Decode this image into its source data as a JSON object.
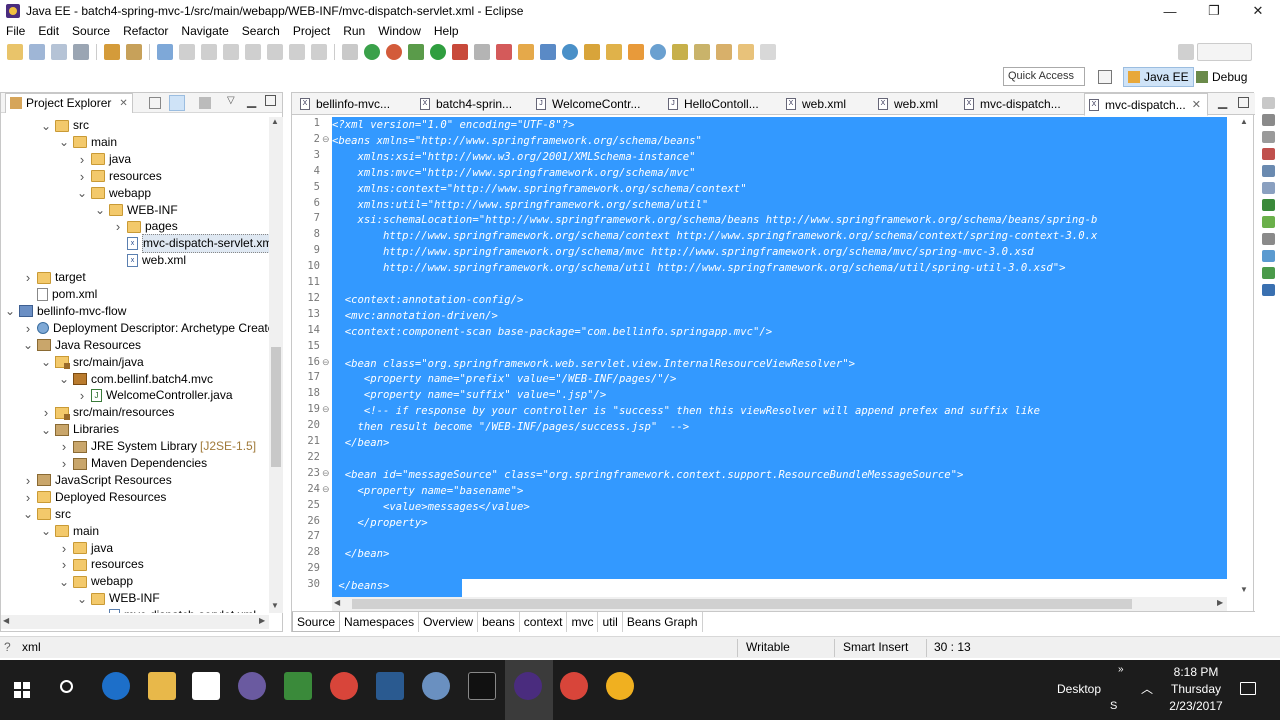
{
  "window": {
    "title": "Java EE - batch4-spring-mvc-1/src/main/webapp/WEB-INF/mvc-dispatch-servlet.xml - Eclipse",
    "controls": {
      "minimize": "—",
      "restore": "❐",
      "close": "✕"
    }
  },
  "menu": [
    "File",
    "Edit",
    "Source",
    "Refactor",
    "Navigate",
    "Search",
    "Project",
    "Run",
    "Window",
    "Help"
  ],
  "toolbar_right": {
    "quick_access": "Quick Access",
    "perspectives": [
      {
        "label": "Java EE",
        "active": true
      },
      {
        "label": "Debug",
        "active": false
      }
    ]
  },
  "explorer": {
    "title": "Project Explorer",
    "close": "✕",
    "tree": [
      {
        "label": "src",
        "depth": 2,
        "icon": "folder",
        "expanded": true
      },
      {
        "label": "main",
        "depth": 3,
        "icon": "folder",
        "expanded": true
      },
      {
        "label": "java",
        "depth": 4,
        "icon": "folder",
        "expanded": false
      },
      {
        "label": "resources",
        "depth": 4,
        "icon": "folder",
        "expanded": false
      },
      {
        "label": "webapp",
        "depth": 4,
        "icon": "folder",
        "expanded": true
      },
      {
        "label": "WEB-INF",
        "depth": 5,
        "icon": "folder",
        "expanded": true
      },
      {
        "label": "pages",
        "depth": 6,
        "icon": "folder",
        "expanded": false
      },
      {
        "label": "mvc-dispatch-servlet.xml",
        "depth": 6,
        "icon": "xml",
        "selected": true
      },
      {
        "label": "web.xml",
        "depth": 6,
        "icon": "xml"
      },
      {
        "label": "target",
        "depth": 1,
        "icon": "folder",
        "expanded": false
      },
      {
        "label": "pom.xml",
        "depth": 1,
        "icon": "file"
      },
      {
        "label": "bellinfo-mvc-flow",
        "depth": 0,
        "icon": "proj",
        "expanded": true
      },
      {
        "label": "Deployment Descriptor: Archetype Create",
        "depth": 1,
        "icon": "globe",
        "expanded": false
      },
      {
        "label": "Java Resources",
        "depth": 1,
        "icon": "lib",
        "expanded": true
      },
      {
        "label": "src/main/java",
        "depth": 2,
        "icon": "pkgfolder",
        "expanded": true
      },
      {
        "label": "com.bellinf.batch4.mvc",
        "depth": 3,
        "icon": "pkg",
        "expanded": true
      },
      {
        "label": "WelcomeController.java",
        "depth": 4,
        "icon": "java",
        "expanded": false
      },
      {
        "label": "src/main/resources",
        "depth": 2,
        "icon": "pkgfolder",
        "expanded": false
      },
      {
        "label": "Libraries",
        "depth": 2,
        "icon": "lib",
        "expanded": true
      },
      {
        "label": "JRE System Library",
        "depth": 3,
        "icon": "lib",
        "decoration": "[J2SE-1.5]",
        "expanded": false
      },
      {
        "label": "Maven Dependencies",
        "depth": 3,
        "icon": "lib",
        "expanded": false
      },
      {
        "label": "JavaScript Resources",
        "depth": 1,
        "icon": "lib",
        "expanded": false
      },
      {
        "label": "Deployed Resources",
        "depth": 1,
        "icon": "folder",
        "expanded": false
      },
      {
        "label": "src",
        "depth": 1,
        "icon": "folder",
        "expanded": true
      },
      {
        "label": "main",
        "depth": 2,
        "icon": "folder",
        "expanded": true
      },
      {
        "label": "java",
        "depth": 3,
        "icon": "folder",
        "expanded": false
      },
      {
        "label": "resources",
        "depth": 3,
        "icon": "folder",
        "expanded": false
      },
      {
        "label": "webapp",
        "depth": 3,
        "icon": "folder",
        "expanded": true
      },
      {
        "label": "WEB-INF",
        "depth": 4,
        "icon": "folder",
        "expanded": true
      },
      {
        "label": "mvc-dispatch-servlet.xml",
        "depth": 5,
        "icon": "xml"
      }
    ]
  },
  "editor": {
    "tabs": [
      {
        "label": "bellinfo-mvc...",
        "icon": "X"
      },
      {
        "label": "batch4-sprin...",
        "icon": "X"
      },
      {
        "label": "WelcomeContr...",
        "icon": "J"
      },
      {
        "label": "HelloContoll...",
        "icon": "J"
      },
      {
        "label": "web.xml",
        "icon": "X"
      },
      {
        "label": "web.xml",
        "icon": "X"
      },
      {
        "label": "mvc-dispatch...",
        "icon": "X"
      },
      {
        "label": "mvc-dispatch...",
        "icon": "X",
        "active": true
      }
    ],
    "lines": [
      "<?xml version=\"1.0\" encoding=\"UTF-8\"?>",
      "<beans xmlns=\"http://www.springframework.org/schema/beans\"",
      "    xmlns:xsi=\"http://www.w3.org/2001/XMLSchema-instance\"",
      "    xmlns:mvc=\"http://www.springframework.org/schema/mvc\"",
      "    xmlns:context=\"http://www.springframework.org/schema/context\"",
      "    xmlns:util=\"http://www.springframework.org/schema/util\"",
      "    xsi:schemaLocation=\"http://www.springframework.org/schema/beans http://www.springframework.org/schema/beans/spring-b",
      "        http://www.springframework.org/schema/context http://www.springframework.org/schema/context/spring-context-3.0.x",
      "        http://www.springframework.org/schema/mvc http://www.springframework.org/schema/mvc/spring-mvc-3.0.xsd",
      "        http://www.springframework.org/schema/util http://www.springframework.org/schema/util/spring-util-3.0.xsd\">",
      "",
      "  <context:annotation-config/>",
      "  <mvc:annotation-driven/>",
      "  <context:component-scan base-package=\"com.bellinfo.springapp.mvc\"/>",
      "",
      "  <bean class=\"org.springframework.web.servlet.view.InternalResourceViewResolver\">",
      "     <property name=\"prefix\" value=\"/WEB-INF/pages/\"/>",
      "     <property name=\"suffix\" value=\".jsp\"/>",
      "     <!-- if response by your controller is \"success\" then this viewResolver will append prefex and suffix like",
      "    then result become \"/WEB-INF/pages/success.jsp\"  -->",
      "  </bean>",
      "",
      "  <bean id=\"messageSource\" class=\"org.springframework.context.support.ResourceBundleMessageSource\">",
      "    <property name=\"basename\">",
      "        <value>messages</value>",
      "    </property>",
      "",
      "  </bean>",
      "",
      " </beans>"
    ],
    "fold_lines": [
      2,
      16,
      19,
      23,
      24
    ],
    "bottom_tabs": [
      {
        "label": "Source",
        "active": true
      },
      {
        "label": "Namespaces"
      },
      {
        "label": "Overview"
      },
      {
        "label": "beans"
      },
      {
        "label": "context"
      },
      {
        "label": "mvc"
      },
      {
        "label": "util"
      },
      {
        "label": "Beans Graph"
      }
    ]
  },
  "status": {
    "left": "xml",
    "left_prefix": "?",
    "writable": "Writable",
    "insert_mode": "Smart Insert",
    "position": "30 : 13"
  },
  "taskbar": {
    "desktop_label": "Desktop",
    "time": "8:18 PM",
    "day": "Thursday",
    "date": "2/23/2017"
  },
  "colors": {
    "selection": "#3399ff",
    "taskbar": "#1c1c1c",
    "perspective_active": "#cfe3f7"
  }
}
